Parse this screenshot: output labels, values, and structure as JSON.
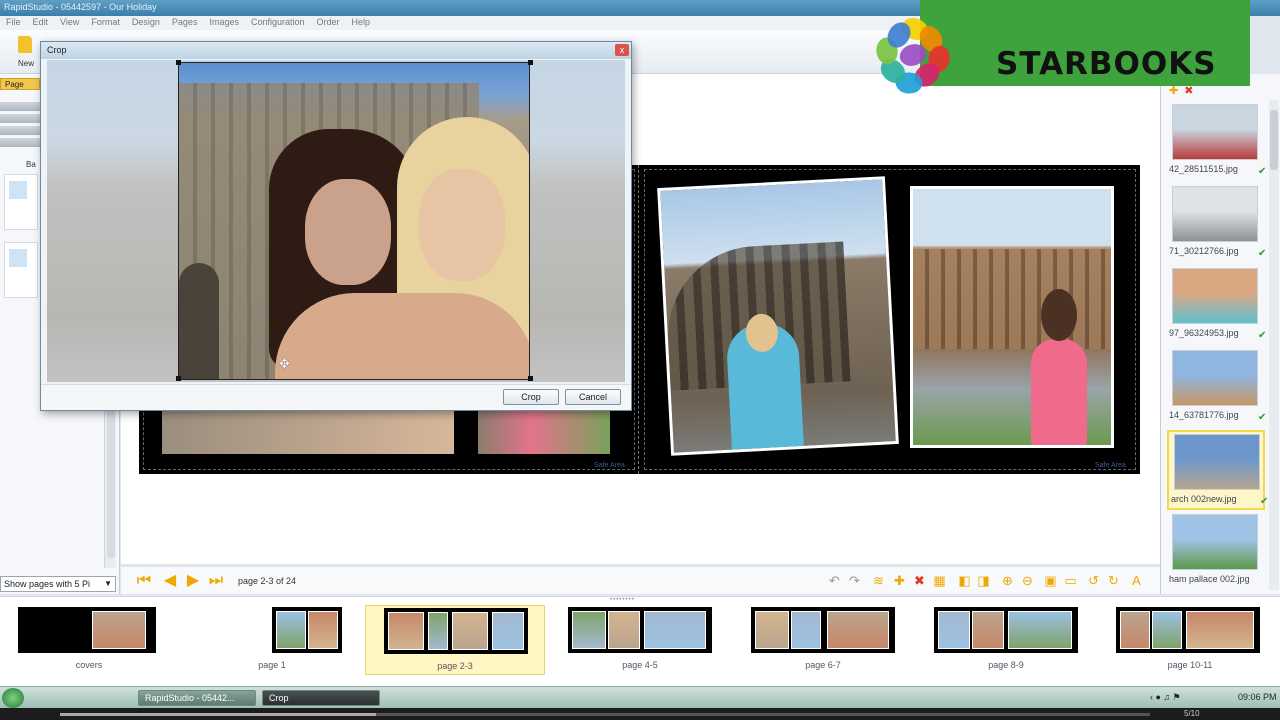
{
  "window": {
    "title": "RapidStudio - 05442597 - Our Holiday"
  },
  "menu": [
    "File",
    "Edit",
    "View",
    "Format",
    "Design",
    "Pages",
    "Images",
    "Configuration",
    "Order",
    "Help"
  ],
  "toolbar": {
    "new_label": "New"
  },
  "left_panel": {
    "tab_label": "Page",
    "section_label": "Ba",
    "pages_select": "Show pages with 5 Pi"
  },
  "canvas": {
    "safe_area_label": "Safe Area",
    "page_indicator": "page 2-3 of 24"
  },
  "crop_dialog": {
    "title": "Crop",
    "close_glyph": "x",
    "crop_button": "Crop",
    "cancel_button": "Cancel"
  },
  "image_list": [
    {
      "name": "42_28511515.jpg",
      "checked": true,
      "selected": false,
      "colors": [
        "#c9d5df",
        "#b93b3b"
      ]
    },
    {
      "name": "71_30212766.jpg",
      "checked": true,
      "selected": false,
      "colors": [
        "#dfe3e8",
        "#8c8f93"
      ]
    },
    {
      "name": "97_96324953.jpg",
      "checked": true,
      "selected": false,
      "colors": [
        "#d9a883",
        "#5fc0d0"
      ]
    },
    {
      "name": "14_63781776.jpg",
      "checked": true,
      "selected": false,
      "colors": [
        "#8fb6e0",
        "#c79865"
      ]
    },
    {
      "name": "arch 002new.jpg",
      "checked": true,
      "selected": true,
      "colors": [
        "#6d96cc",
        "#b8a58e"
      ]
    },
    {
      "name": "ham pallace 002.jpg",
      "checked": false,
      "selected": false,
      "colors": [
        "#9fc3e6",
        "#5d9a4a"
      ]
    }
  ],
  "page_strip": [
    {
      "label": "covers",
      "selected": false
    },
    {
      "label": "page 1",
      "selected": false
    },
    {
      "label": "page 2-3",
      "selected": true
    },
    {
      "label": "page 4-5",
      "selected": false
    },
    {
      "label": "page 6-7",
      "selected": false
    },
    {
      "label": "page 8-9",
      "selected": false
    },
    {
      "label": "page 10-11",
      "selected": false
    }
  ],
  "taskbar": {
    "task1": "RapidStudio - 05442...",
    "task2": "Crop",
    "clock": "09:06 PM"
  },
  "video": {
    "time": "5/10",
    "progress": 0.29
  },
  "overlay_logo": {
    "text": "STARBOOKS",
    "petal_colors": [
      "#f5d000",
      "#f08a00",
      "#e8322b",
      "#d6246e",
      "#1f9fd8",
      "#2bb0a0",
      "#7cc242",
      "#3f7fd0",
      "#9a4fc2"
    ]
  },
  "colors": {
    "accent": "#f0a800",
    "brand_green": "#3ea33c",
    "selection_yellow": "#fff6c2"
  }
}
